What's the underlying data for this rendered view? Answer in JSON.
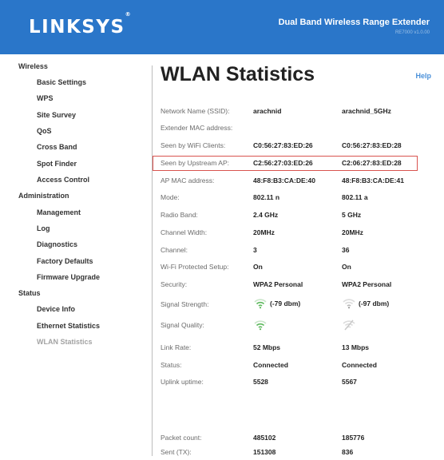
{
  "header": {
    "logo": "LINKSYS",
    "logo_mark": "®",
    "product_name": "Dual Band Wireless Range Extender",
    "model": "RE7000 v1.0.00",
    "bg_color": "#2a76c9"
  },
  "sidebar": {
    "sections": [
      {
        "title": "Wireless",
        "items": [
          "Basic Settings",
          "WPS",
          "Site Survey",
          "QoS",
          "Cross Band",
          "Spot Finder",
          "Access Control"
        ]
      },
      {
        "title": "Administration",
        "items": [
          "Management",
          "Log",
          "Diagnostics",
          "Factory Defaults",
          "Firmware Upgrade"
        ]
      },
      {
        "title": "Status",
        "items": [
          "Device Info",
          "Ethernet Statistics",
          "WLAN Statistics"
        ]
      }
    ],
    "active_item": "WLAN Statistics"
  },
  "main": {
    "title": "WLAN Statistics",
    "help_link": "Help",
    "rows": [
      {
        "label": "Network Name (SSID):",
        "v1": "arachnid",
        "v2": "arachnid_5GHz"
      },
      {
        "label": "Extender MAC address:",
        "v1": "",
        "v2": ""
      },
      {
        "label": "Seen by WiFi Clients:",
        "v1": "C0:56:27:83:ED:26",
        "v2": "C0:56:27:83:ED:28"
      },
      {
        "label": "Seen by Upstream AP:",
        "v1": "C2:56:27:03:ED:26",
        "v2": "C2:06:27:83:ED:28"
      },
      {
        "label": "AP MAC address:",
        "v1": "48:F8:B3:CA:DE:40",
        "v2": "48:F8:B3:CA:DE:41"
      },
      {
        "label": "Mode:",
        "v1": "802.11 n",
        "v2": "802.11 a"
      },
      {
        "label": "Radio Band:",
        "v1": "2.4 GHz",
        "v2": "5 GHz"
      },
      {
        "label": "Channel Width:",
        "v1": "20MHz",
        "v2": "20MHz"
      },
      {
        "label": "Channel:",
        "v1": "3",
        "v2": "36"
      },
      {
        "label": "Wi-Fi Protected Setup:",
        "v1": "On",
        "v2": "On"
      },
      {
        "label": "Security:",
        "v1": "WPA2 Personal",
        "v2": "WPA2 Personal"
      },
      {
        "label": "Signal Strength:",
        "v1": "(-79 dbm)",
        "v2": "(-97 dbm)"
      },
      {
        "label": "Signal Quality:",
        "v1": "",
        "v2": ""
      },
      {
        "label": "Link Rate:",
        "v1": "52 Mbps",
        "v2": "13 Mbps"
      },
      {
        "label": "Status:",
        "v1": "Connected",
        "v2": "Connected"
      },
      {
        "label": "Uplink uptime:",
        "v1": "5528",
        "v2": "5567"
      },
      {
        "label": "Packet count:",
        "v1": "485102",
        "v2": "185776"
      },
      {
        "label": "Sent (TX):",
        "v1": "151308",
        "v2": "836"
      }
    ],
    "signal_icons": {
      "strength_1": "wifi-signal-icon",
      "strength_2": "wifi-weak-signal-icon",
      "quality_1": "wifi-signal-icon",
      "quality_2": "wifi-no-signal-icon"
    },
    "signal_color": "#5cb85c",
    "highlight_color": "#d9534f"
  }
}
